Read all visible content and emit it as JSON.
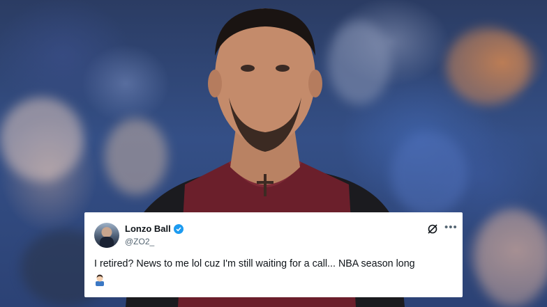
{
  "tweet": {
    "name": "Lonzo Ball",
    "handle": "@ZO2_",
    "text": "I retired? News to me lol cuz I'm still waiting for a call... NBA season long",
    "verified_color": "#1d9bf0",
    "emoji_icon": "man-emoji-icon",
    "grok_icon": "grok-icon",
    "more_icon": "more-options-icon"
  },
  "colors": {
    "jersey": "#6b1f2b",
    "card_bg": "#ffffff",
    "text": "#0f1419",
    "subtext": "#536471"
  }
}
